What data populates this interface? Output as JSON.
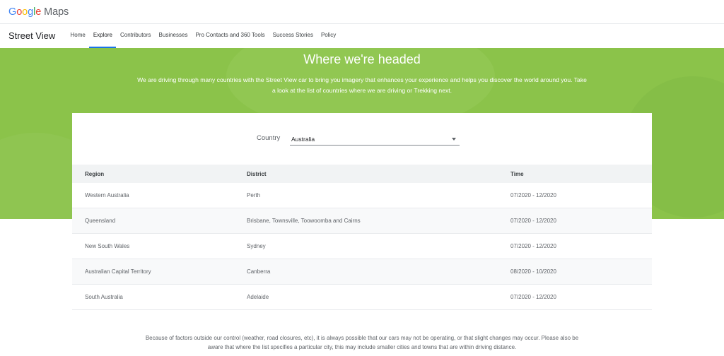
{
  "header": {
    "logo": {
      "G": "G",
      "o1": "o",
      "o2": "o",
      "g": "g",
      "l": "l",
      "e": "e",
      "maps": "Maps"
    }
  },
  "nav": {
    "brand": "Street View",
    "links": [
      {
        "label": "Home",
        "active": false
      },
      {
        "label": "Explore",
        "active": true
      },
      {
        "label": "Contributors",
        "active": false
      },
      {
        "label": "Businesses",
        "active": false
      },
      {
        "label": "Pro Contacts and 360 Tools",
        "active": false
      },
      {
        "label": "Success Stories",
        "active": false
      },
      {
        "label": "Policy",
        "active": false
      }
    ]
  },
  "hero": {
    "title": "Where we're headed",
    "description": "We are driving through many countries with the Street View car to bring you imagery that enhances your experience and helps you discover the world around you. Take a look at the list of countries where we are driving or Trekking next.",
    "background_color": "#8bc34a"
  },
  "selector": {
    "label": "Country",
    "value": "Australia",
    "icon": "caret-down-icon"
  },
  "table": {
    "headers": {
      "region": "Region",
      "district": "District",
      "time": "Time"
    },
    "rows": [
      {
        "region": "Western Australia",
        "district": "Perth",
        "time": "07/2020 - 12/2020"
      },
      {
        "region": "Queensland",
        "district": "Brisbane, Townsville, Toowoomba and Cairns",
        "time": "07/2020 - 12/2020"
      },
      {
        "region": "New South Wales",
        "district": "Sydney",
        "time": "07/2020 - 12/2020"
      },
      {
        "region": "Australian Capital Territory",
        "district": "Canberra",
        "time": "08/2020 - 10/2020"
      },
      {
        "region": "South Australia",
        "district": "Adelaide",
        "time": "07/2020 - 12/2020"
      }
    ]
  },
  "footer_note": "Because of factors outside our control (weather, road closures, etc), it is always possible that our cars may not be operating, or that slight changes may occur. Please also be aware that where the list specifies a particular city, this may include smaller cities and towns that are within driving distance."
}
